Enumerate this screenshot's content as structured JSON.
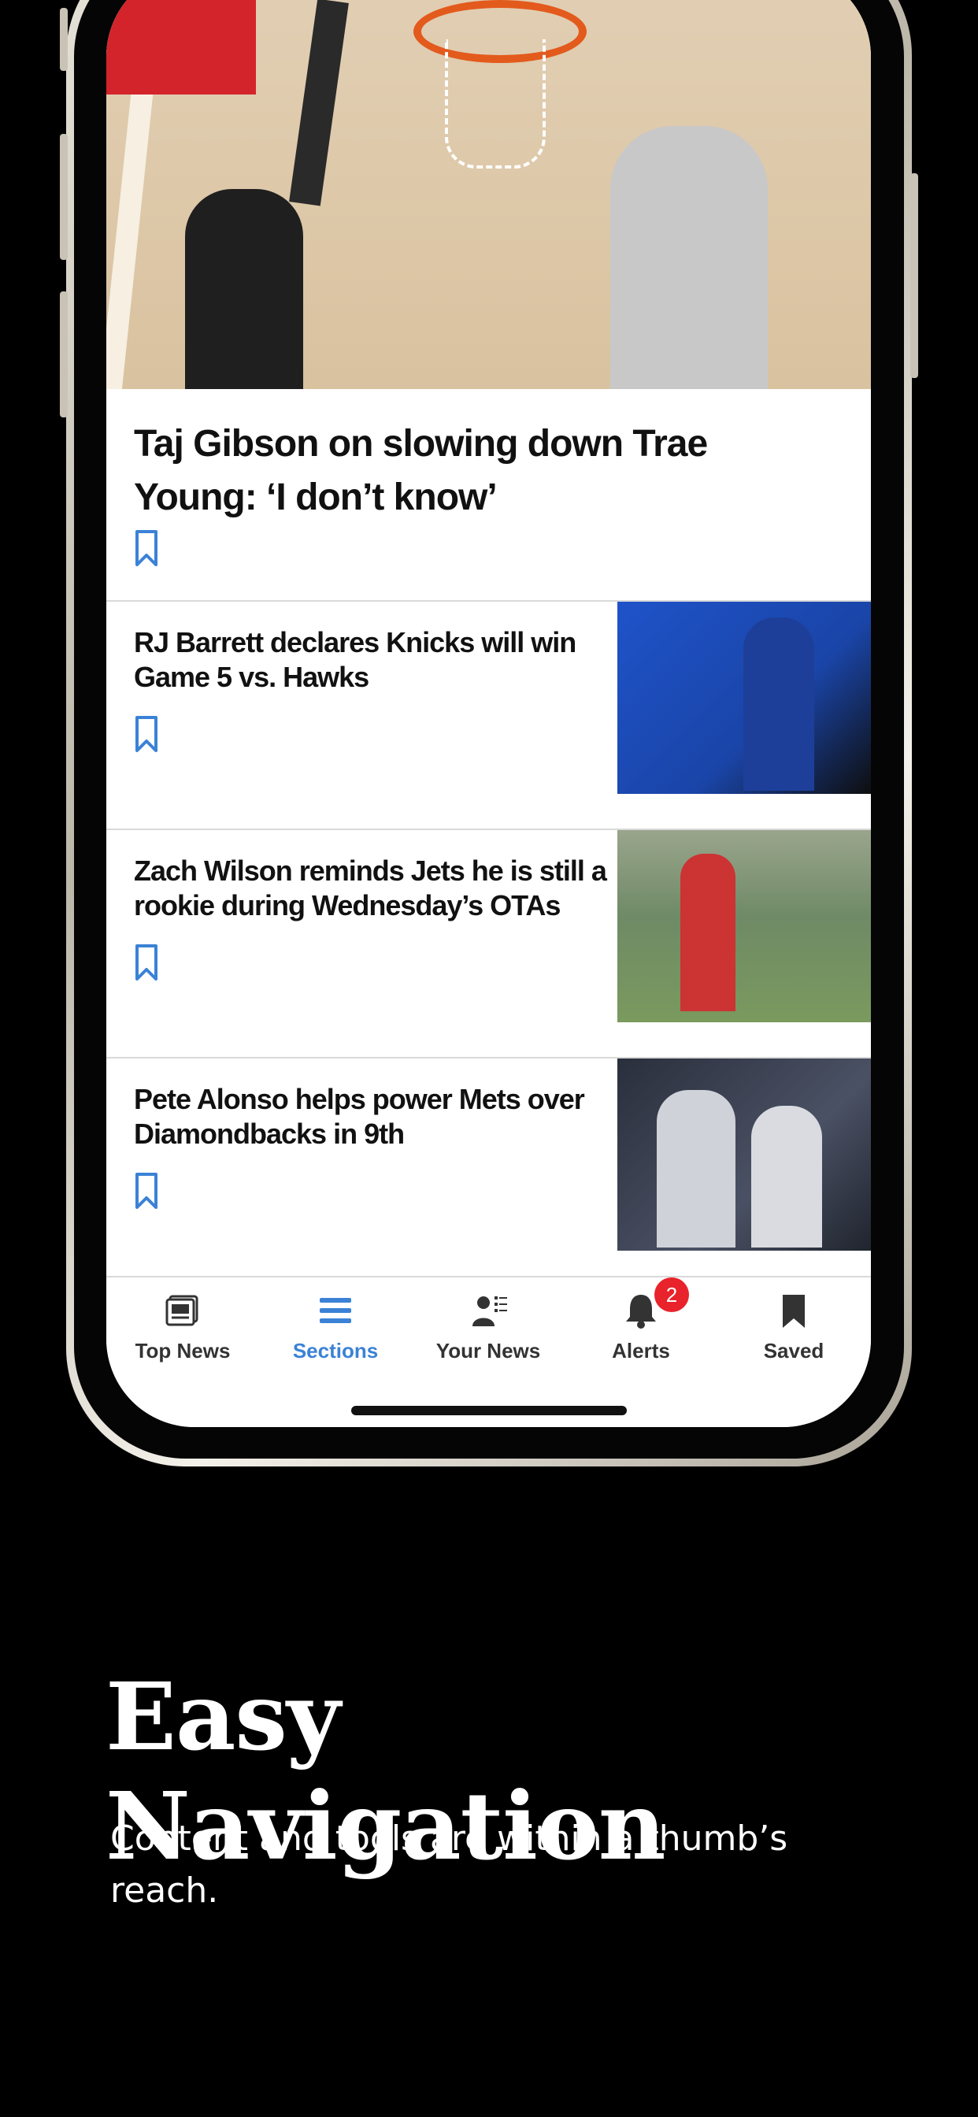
{
  "lead_story": {
    "title": "Taj Gibson on slowing down Trae Young: ‘I don’t know’"
  },
  "stories": [
    {
      "title": "RJ Barrett declares Knicks will win Game 5 vs. Hawks"
    },
    {
      "title": "Zach Wilson reminds Jets he is still a rookie during Wednesday’s OTAs"
    },
    {
      "title": "Pete Alonso helps power Mets over Diamondbacks in 9th"
    }
  ],
  "tabbar": {
    "tabs": [
      {
        "label": "Top News",
        "icon": "newspaper-icon"
      },
      {
        "label": "Sections",
        "icon": "menu-icon",
        "active": true
      },
      {
        "label": "Your News",
        "icon": "person-list-icon"
      },
      {
        "label": "Alerts",
        "icon": "bell-icon",
        "badge": "2"
      },
      {
        "label": "Saved",
        "icon": "bookmark-icon"
      }
    ]
  },
  "promo": {
    "headline": "Easy Navigation",
    "subline": "Content and tools are within a thumb’s reach."
  },
  "colors": {
    "accent": "#3b82d6",
    "badge": "#e8232b",
    "background": "#000000"
  }
}
